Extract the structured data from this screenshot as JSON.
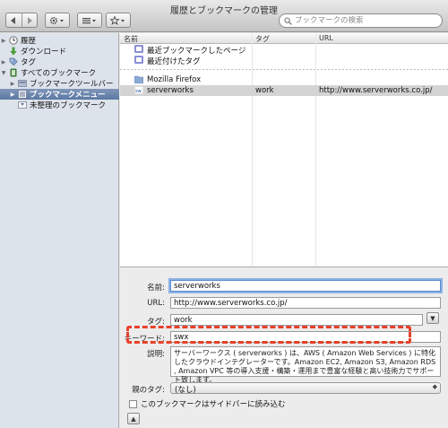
{
  "window": {
    "title": "履歴とブックマークの管理"
  },
  "toolbar": {
    "back_icon": "arrow-left-icon",
    "forward_icon": "arrow-right-icon",
    "gear_icon": "gear-icon",
    "view_icon": "list-view-icon",
    "import_icon": "star-icon",
    "search_placeholder": "ブックマークの検索"
  },
  "sidebar": {
    "items": [
      {
        "label": "履歴"
      },
      {
        "label": "ダウンロード"
      },
      {
        "label": "タグ"
      },
      {
        "label": "すべてのブックマーク"
      },
      {
        "label": "ブックマークツールバー"
      },
      {
        "label": "ブックマークメニュー"
      },
      {
        "label": "未整理のブックマーク"
      }
    ]
  },
  "list": {
    "columns": [
      "名前",
      "タグ",
      "URL"
    ],
    "rows": [
      {
        "name": "最近ブックマークしたページ",
        "tag": "",
        "url": ""
      },
      {
        "name": "最近付けたタグ",
        "tag": "",
        "url": ""
      },
      {
        "name": "Mozilla Firefox",
        "tag": "",
        "url": ""
      },
      {
        "name": "serverworks",
        "tag": "work",
        "url": "http://www.serverworks.co.jp/"
      }
    ]
  },
  "detail": {
    "name_label": "名前:",
    "name_value": "serverworks",
    "url_label": "URL:",
    "url_value": "http://www.serverworks.co.jp/",
    "tag_label": "タグ:",
    "tag_value": "work",
    "keyword_label": "キーワード:",
    "keyword_value": "swx",
    "desc_label": "説明:",
    "desc_value": "サーバーワークス ( serverworks ) は、AWS ( Amazon Web Services ) に特化したクラウドインテグレーターです。Amazon EC2, Amazon S3, Amazon RDS , Amazon VPC 等の導入支援・構築・運用まで豊富な経験と高い技術力でサポート致します。",
    "parent_label": "親のタグ:",
    "parent_value": "(なし)",
    "sidebar_checkbox_label": "このブックマークはサイドバーに読み込む"
  },
  "colors": {
    "annotation": "#e8402a",
    "selection": "#5c78a3"
  }
}
